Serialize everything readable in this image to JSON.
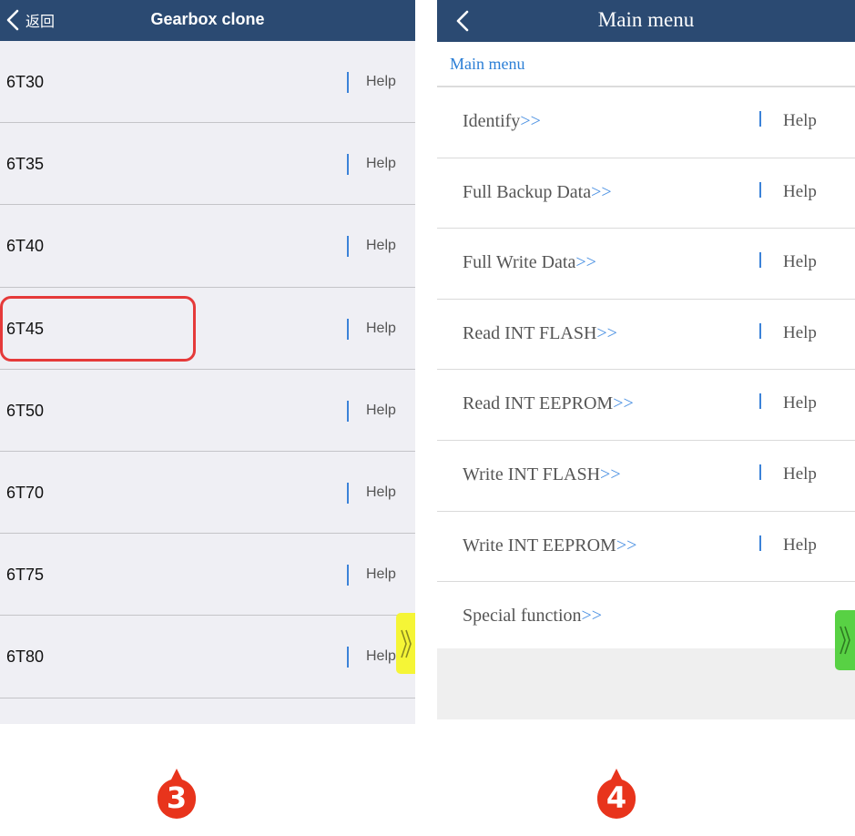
{
  "left_screen": {
    "back_label": "返回",
    "title": "Gearbox clone",
    "items": [
      {
        "code": "6T30",
        "help": "Help"
      },
      {
        "code": "6T35",
        "help": "Help"
      },
      {
        "code": "6T40",
        "help": "Help"
      },
      {
        "code": "6T45",
        "help": "Help",
        "highlighted": true
      },
      {
        "code": "6T50",
        "help": "Help"
      },
      {
        "code": "6T70",
        "help": "Help"
      },
      {
        "code": "6T75",
        "help": "Help"
      },
      {
        "code": "6T80",
        "help": "Help"
      }
    ],
    "side_tab_icon": "double-chevron-right-icon",
    "side_tab_color": "#f5f536",
    "highlight_color": "#e53a3a"
  },
  "right_screen": {
    "title": "Main menu",
    "breadcrumb": "Main menu",
    "arrow_suffix": ">>",
    "items": [
      {
        "label": "Identify",
        "help": "Help"
      },
      {
        "label": "Full Backup Data",
        "help": "Help"
      },
      {
        "label": "Full Write Data",
        "help": "Help"
      },
      {
        "label": "Read INT FLASH",
        "help": "Help"
      },
      {
        "label": "Read INT EEPROM",
        "help": "Help"
      },
      {
        "label": "Write INT FLASH",
        "help": "Help"
      },
      {
        "label": "Write INT EEPROM",
        "help": "Help"
      },
      {
        "label": "Special function",
        "help": ""
      }
    ],
    "side_tab_icon": "double-chevron-right-icon",
    "side_tab_color": "#58d144"
  },
  "step_badges": [
    {
      "number": "3",
      "color": "#e8341c"
    },
    {
      "number": "4",
      "color": "#e8341c"
    }
  ],
  "colors": {
    "nav_bar": "#2b4a72",
    "accent_blue": "#3b82d8"
  }
}
